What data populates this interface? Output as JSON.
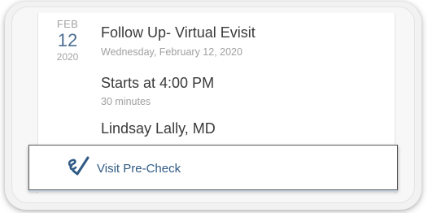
{
  "appointment": {
    "month": "FEB",
    "day": "12",
    "year": "2020",
    "title": "Follow Up- Virtual Evisit",
    "date_full": "Wednesday, February 12, 2020",
    "start_time": "Starts at 4:00 PM",
    "duration": "30 minutes",
    "provider": "Lindsay Lally, MD"
  },
  "action": {
    "label": "Visit Pre-Check",
    "icon": "echeck-icon"
  },
  "colors": {
    "accent": "#2f5a84",
    "day_number": "#4d6f93",
    "primary_text": "#3a3a3a",
    "secondary_text": "#a0a0a0"
  }
}
